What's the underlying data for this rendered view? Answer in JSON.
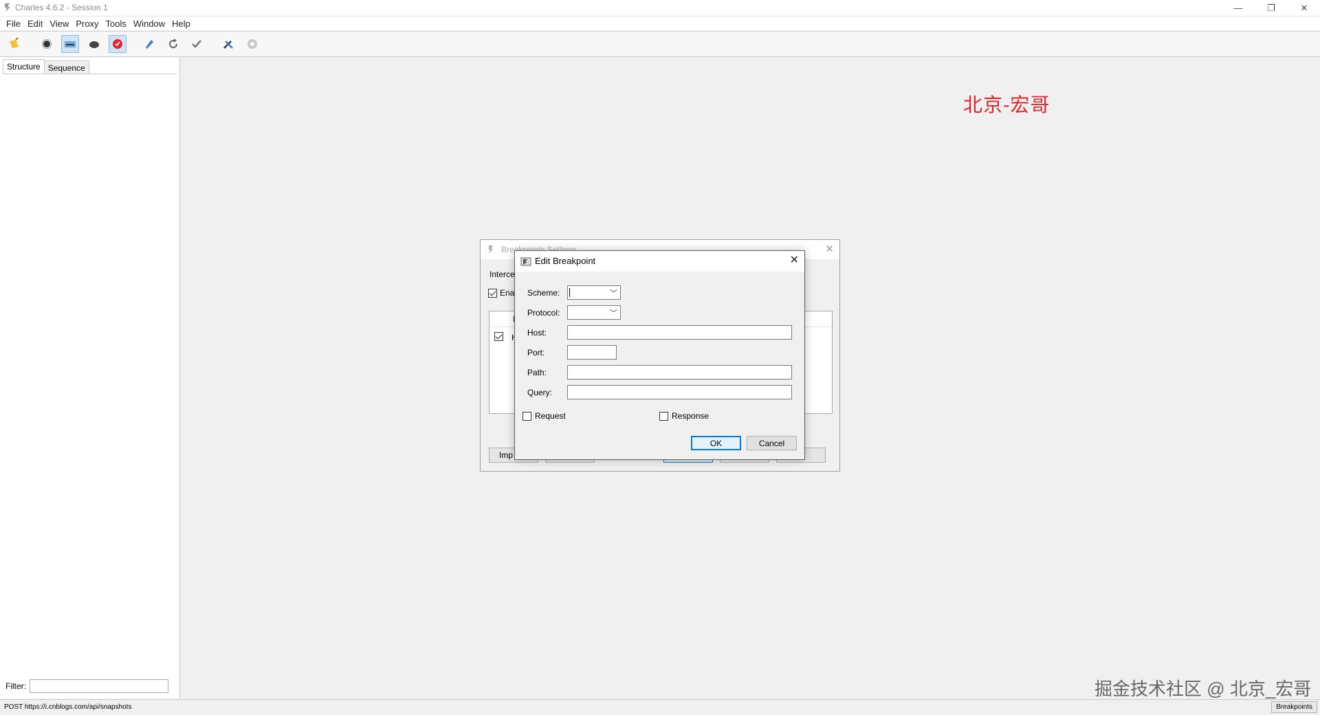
{
  "window": {
    "title": "Charles 4.6.2 - Session 1",
    "minimize": "—",
    "restore": "❐",
    "close": "✕"
  },
  "menu": [
    "File",
    "Edit",
    "View",
    "Proxy",
    "Tools",
    "Window",
    "Help"
  ],
  "left_pane": {
    "tabs": [
      "Structure",
      "Sequence"
    ],
    "filter_label": "Filter:",
    "filter_value": ""
  },
  "watermark": {
    "top": "北京-宏哥",
    "bottom": "掘金技术社区 @ 北京_宏哥"
  },
  "status": {
    "text": "POST https://i.cnblogs.com/api/snapshots",
    "right_button": "Breakpoints"
  },
  "breakpoints_dialog": {
    "title": "Breakpoints Settings",
    "intercept_label": "Interce",
    "enable_label": "Ena",
    "row_text": "H",
    "header_text": "I",
    "buttons": [
      "Imp",
      "",
      "",
      "",
      "p"
    ]
  },
  "edit_dialog": {
    "title": "Edit Breakpoint",
    "fields": {
      "scheme": {
        "label": "Scheme:",
        "value": ""
      },
      "protocol": {
        "label": "Protocol:",
        "value": ""
      },
      "host": {
        "label": "Host:",
        "value": ""
      },
      "port": {
        "label": "Port:",
        "value": ""
      },
      "path": {
        "label": "Path:",
        "value": ""
      },
      "query": {
        "label": "Query:",
        "value": ""
      }
    },
    "request_label": "Request",
    "response_label": "Response",
    "ok": "OK",
    "cancel": "Cancel"
  }
}
